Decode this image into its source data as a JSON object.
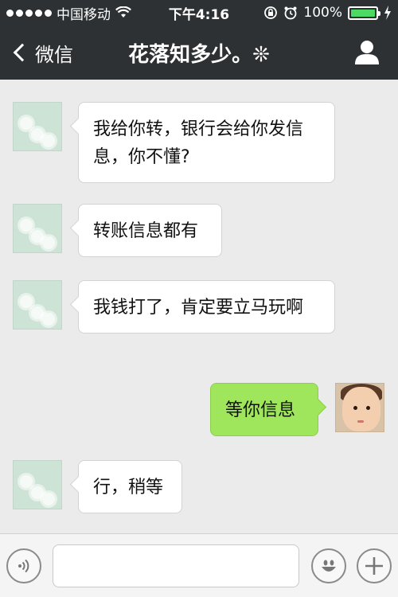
{
  "status_bar": {
    "carrier": "中国移动",
    "time": "下午4:16",
    "battery": "100%"
  },
  "nav": {
    "back_label": "微信",
    "title": "花落知多少。❊"
  },
  "messages": [
    {
      "direction": "in",
      "text": "我给你转，银行会给你发信息，你不懂?"
    },
    {
      "direction": "in",
      "text": "转账信息都有"
    },
    {
      "direction": "in",
      "text": "我钱打了，肯定要立马玩啊"
    },
    {
      "direction": "out",
      "text": "等你信息"
    },
    {
      "direction": "in",
      "text": "行，稍等"
    }
  ],
  "input": {
    "value": "",
    "placeholder": ""
  },
  "icons": {
    "voice": "voice-icon",
    "emoji": "emoji-icon",
    "add": "plus-icon",
    "profile": "person-icon",
    "back": "chevron-left-icon"
  }
}
